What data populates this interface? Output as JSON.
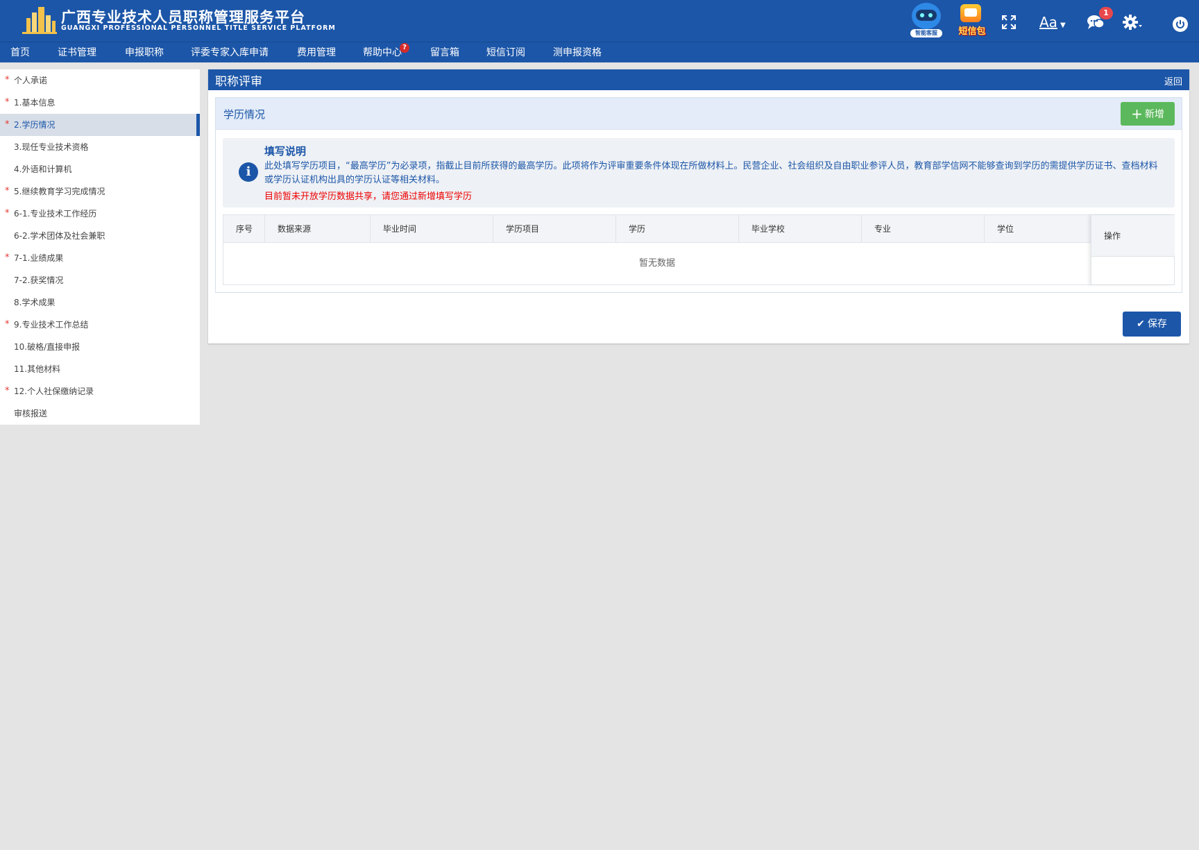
{
  "header": {
    "title_cn": "广西专业技术人员职称管理服务平台",
    "title_en": "GUANGXI PROFESSIONAL PERSONNEL TITLE SERVICE PLATFORM",
    "robot_label": "智能客服",
    "sms_label": "短信包",
    "font_label": "Aa",
    "message_badge": "1"
  },
  "nav": {
    "items": [
      "首页",
      "证书管理",
      "申报职称",
      "评委专家入库申请",
      "费用管理",
      "帮助中心",
      "留言箱",
      "短信订阅",
      "测申报资格"
    ],
    "help_badge": "?"
  },
  "sidebar": {
    "items": [
      {
        "label": "个人承诺",
        "required": true
      },
      {
        "label": "1.基本信息",
        "required": true
      },
      {
        "label": "2.学历情况",
        "required": true,
        "active": true
      },
      {
        "label": "3.现任专业技术资格",
        "required": false
      },
      {
        "label": "4.外语和计算机",
        "required": false
      },
      {
        "label": "5.继续教育学习完成情况",
        "required": true
      },
      {
        "label": "6-1.专业技术工作经历",
        "required": true
      },
      {
        "label": "6-2.学术团体及社会兼职",
        "required": false
      },
      {
        "label": "7-1.业绩成果",
        "required": true
      },
      {
        "label": "7-2.获奖情况",
        "required": false
      },
      {
        "label": "8.学术成果",
        "required": false
      },
      {
        "label": "9.专业技术工作总结",
        "required": true
      },
      {
        "label": "10.破格/直接申报",
        "required": false
      },
      {
        "label": "11.其他材料",
        "required": false
      },
      {
        "label": "12.个人社保缴纳记录",
        "required": true
      },
      {
        "label": "审核报送",
        "required": false
      }
    ],
    "required_mark": "*"
  },
  "panel": {
    "title": "职称评审",
    "back": "返回",
    "section_title": "学历情况",
    "add_label": "新增",
    "add_symbol": "+",
    "notice_title": "填写说明",
    "notice_icon": "i",
    "notice_text": "此处填写学历项目，“最高学历”为必录项，指截止目前所获得的最高学历。此项将作为评审重要条件体现在所做材料上。民营企业、社会组织及自由职业参评人员，教育部学信网不能够查询到学历的需提供学历证书、查档材料或学历认证机构出具的学历认证等相关材料。",
    "notice_warning": "目前暂未开放学历数据共享，请您通过新增填写学历",
    "table_headers": [
      "序号",
      "数据来源",
      "毕业时间",
      "学历项目",
      "学历",
      "毕业学校",
      "专业",
      "学位"
    ],
    "ops_header": "操作",
    "empty_text": "暂无数据",
    "save_label": "保存",
    "save_symbol": "✔"
  },
  "colors": {
    "brand": "#1c56a8",
    "success": "#5cb85c",
    "danger": "#e00000"
  }
}
